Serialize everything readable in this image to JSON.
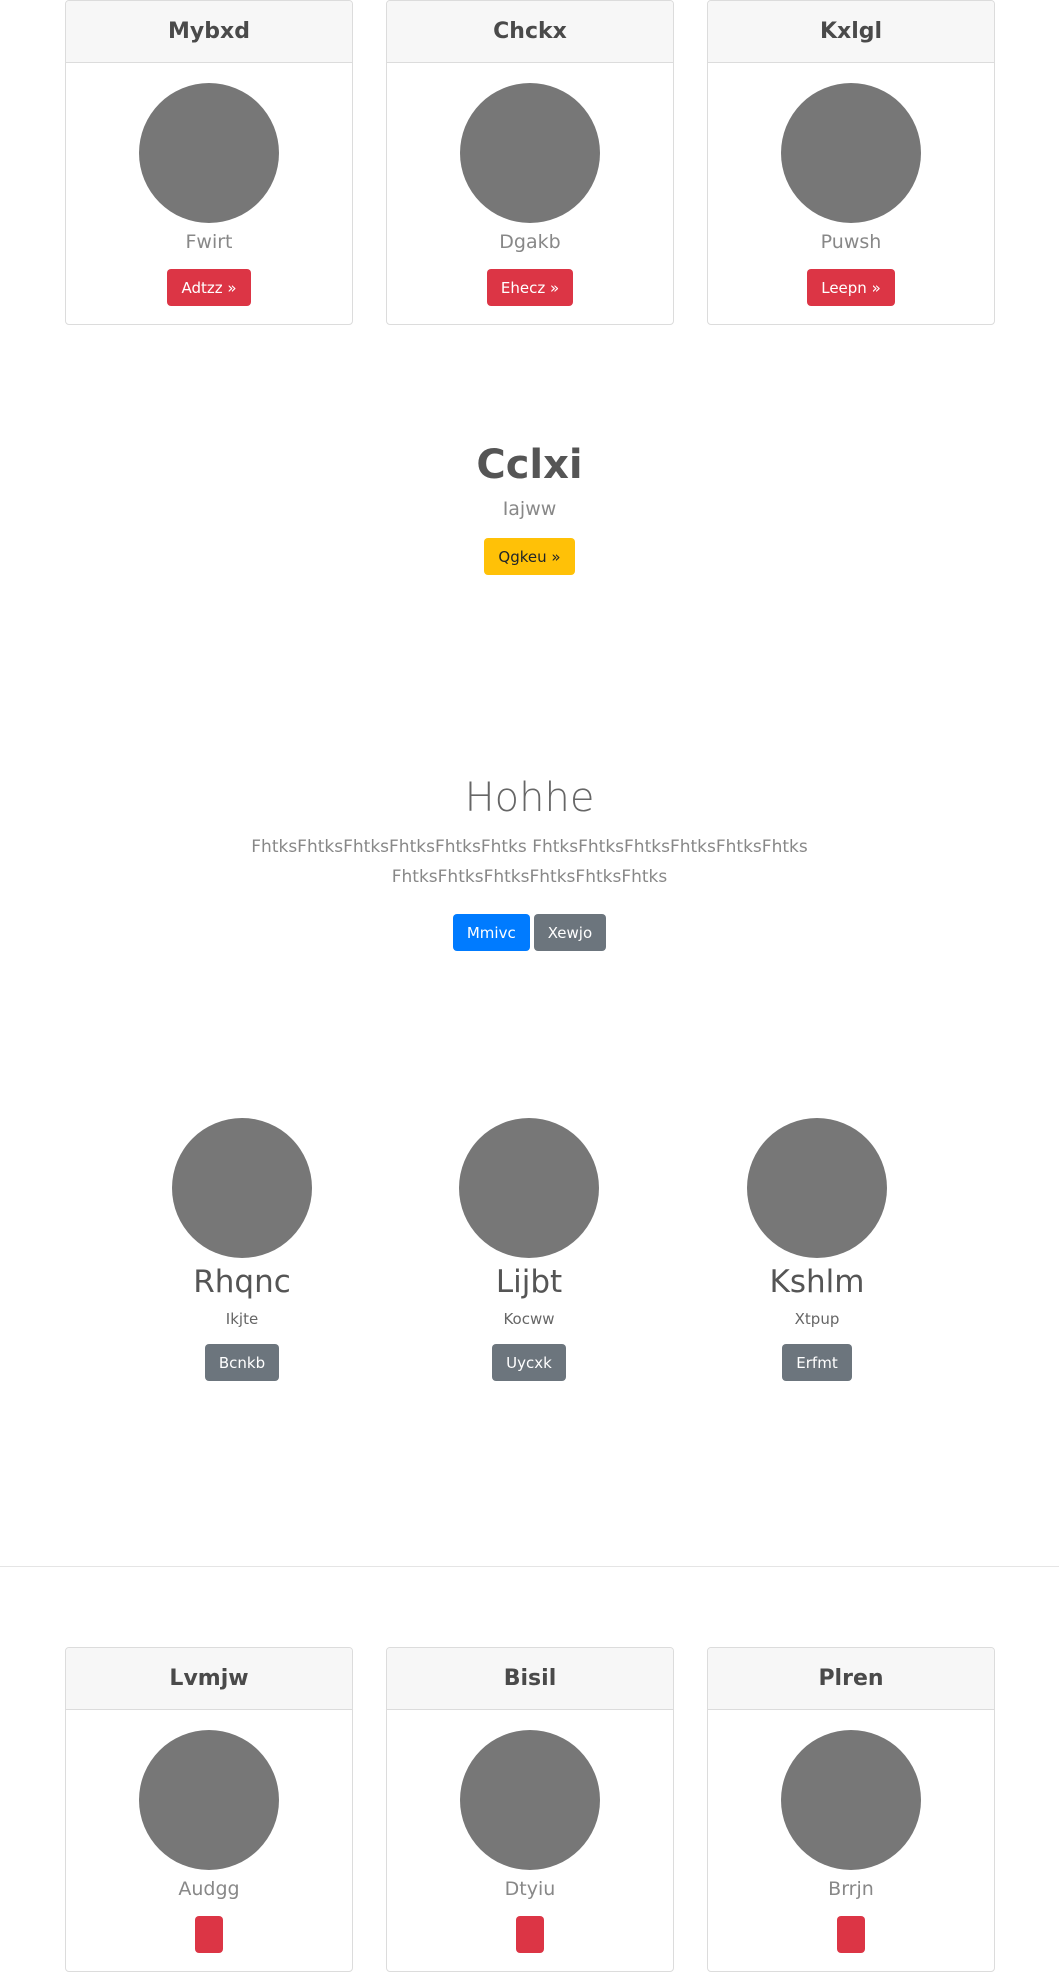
{
  "top_cards": [
    {
      "title": "Mybxd",
      "subtitle": "Fwirt",
      "button": "Adtzz »"
    },
    {
      "title": "Chckx",
      "subtitle": "Dgakb",
      "button": "Ehecz »"
    },
    {
      "title": "Kxlgl",
      "subtitle": "Puwsh",
      "button": "Leepn »"
    }
  ],
  "hero_one": {
    "title": "Cclxi",
    "subtitle": "Iajww",
    "button": "Qgkeu »"
  },
  "hero_two": {
    "title": "Hohhe",
    "lead": "FhtksFhtksFhtksFhtksFhtksFhtks FhtksFhtksFhtksFhtksFhtksFhtks FhtksFhtksFhtksFhtksFhtksFhtks",
    "primary_button": "Mmivc",
    "secondary_button": "Xewjo"
  },
  "people": [
    {
      "name": "Rhqnc",
      "role": "Ikjte",
      "button": "Bcnkb"
    },
    {
      "name": "Lijbt",
      "role": "Kocww",
      "button": "Uycxk"
    },
    {
      "name": "Kshlm",
      "role": "Xtpup",
      "button": "Erfmt"
    }
  ],
  "bottom_cards": [
    {
      "title": "Lvmjw",
      "subtitle": "Audgg"
    },
    {
      "title": "Bisil",
      "subtitle": "Dtyiu"
    },
    {
      "title": "Plren",
      "subtitle": "Brrjn"
    }
  ],
  "colors": {
    "danger": "#dc3545",
    "warning": "#ffc107",
    "primary": "#007bff",
    "secondary": "#6c757d",
    "avatar": "#777777"
  }
}
